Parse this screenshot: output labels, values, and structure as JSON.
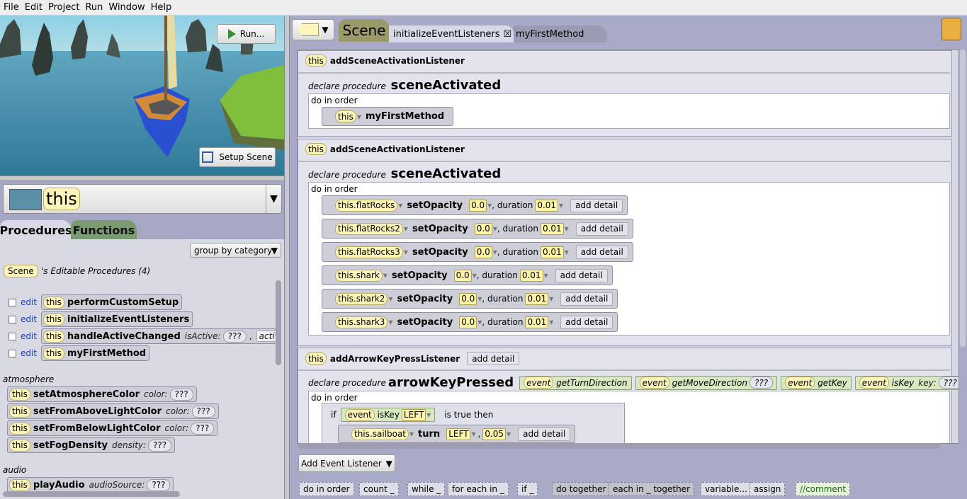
{
  "menu": [
    "File",
    "Edit",
    "Project",
    "Run",
    "Window",
    "Help"
  ],
  "scene_view": {
    "run_label": "Run...",
    "setup_label": "Setup Scene"
  },
  "selector": {
    "value": "this"
  },
  "tabs": {
    "procedures": "Procedures",
    "functions": "Functions"
  },
  "group_by": "group by category",
  "scene_badge": "Scene",
  "editable_heading": "'s Editable Procedures (4)",
  "edit_label": "edit",
  "this_label": "this",
  "editable_procs": [
    {
      "name": "performCustomSetup"
    },
    {
      "name": "initializeEventListeners"
    },
    {
      "name": "handleActiveChanged",
      "param": "isActive:",
      "value": "???",
      "param2": "activati"
    },
    {
      "name": "myFirstMethod"
    }
  ],
  "categories": [
    {
      "label": "atmosphere",
      "items": [
        {
          "name": "setAtmosphereColor",
          "param": "color:",
          "value": "???"
        },
        {
          "name": "setFromAboveLightColor",
          "param": "color:",
          "value": "???"
        },
        {
          "name": "setFromBelowLightColor",
          "param": "color:",
          "value": "???"
        },
        {
          "name": "setFogDensity",
          "param": "density:",
          "value": "???"
        }
      ]
    },
    {
      "label": "audio",
      "items": [
        {
          "name": "playAudio",
          "param": "audioSource:",
          "value": "???"
        }
      ]
    }
  ],
  "editor_tabs": {
    "scene": "Scene",
    "t1": "initializeEventListeners",
    "t1_close": "☒",
    "t2": "myFirstMethod"
  },
  "listeners": [
    {
      "this": "this",
      "name": "addSceneActivationListener",
      "declare": "declare procedure",
      "proc": "sceneActivated",
      "doinorder": "do in order",
      "call": {
        "target": "this",
        "method": "myFirstMethod"
      }
    },
    {
      "this": "this",
      "name": "addSceneActivationListener",
      "declare": "declare procedure",
      "proc": "sceneActivated",
      "doinorder": "do in order",
      "statements": [
        {
          "target": "this.flatRocks",
          "method": "setOpacity",
          "value": "0.0",
          "duration_label": ", duration",
          "duration": "0.01",
          "detail": "add detail"
        },
        {
          "target": "this.flatRocks2",
          "method": "setOpacity",
          "value": "0.0",
          "duration_label": ", duration",
          "duration": "0.01",
          "detail": "add detail"
        },
        {
          "target": "this.flatRocks3",
          "method": "setOpacity",
          "value": "0.0",
          "duration_label": ", duration",
          "duration": "0.01",
          "detail": "add detail"
        },
        {
          "target": "this.shark",
          "method": "setOpacity",
          "value": "0.0",
          "duration_label": ", duration",
          "duration": "0.01",
          "detail": "add detail"
        },
        {
          "target": "this.shark2",
          "method": "setOpacity",
          "value": "0.0",
          "duration_label": ", duration",
          "duration": "0.01",
          "detail": "add detail"
        },
        {
          "target": "this.shark3",
          "method": "setOpacity",
          "value": "0.0",
          "duration_label": ", duration",
          "duration": "0.01",
          "detail": "add detail"
        }
      ]
    },
    {
      "this": "this",
      "name": "addArrowKeyPressListener",
      "detail": "add detail",
      "declare": "declare procedure",
      "proc": "arrowKeyPressed",
      "doinorder": "do in order",
      "event_funcs": [
        {
          "ev": "event",
          "fn": "getTurnDirection"
        },
        {
          "ev": "event",
          "fn": "getMoveDirection",
          "extra": "???"
        },
        {
          "ev": "event",
          "fn": "getKey"
        },
        {
          "ev": "event",
          "fn": "isKey",
          "param": "key:",
          "extra": "???"
        }
      ],
      "if_block": {
        "if": "if",
        "ev": "event",
        "fn": "isKey",
        "key": "LEFT",
        "then": "is true then",
        "body": {
          "target": "this.sailboat",
          "method": "turn",
          "dir": "LEFT",
          "amount": "0.05",
          "detail": "add detail"
        }
      }
    }
  ],
  "add_event_listener": "Add Event Listener",
  "controls": [
    "do in order",
    "count _",
    "while _",
    "for each in _",
    "if _",
    "do together",
    "each in _ together",
    "variable...",
    "assign",
    "//comment"
  ]
}
